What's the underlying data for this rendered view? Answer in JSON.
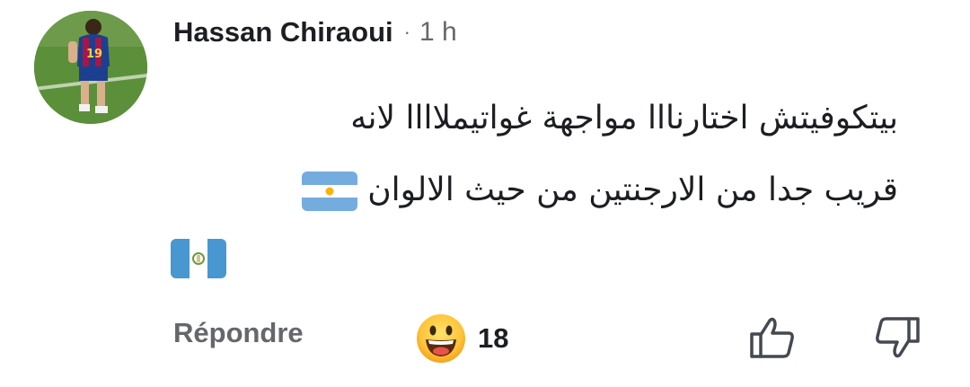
{
  "comment": {
    "author": "Hassan Chiraoui",
    "separator": "·",
    "time": "1 h",
    "text_line1": "بيتكوفيتش  اختارنااا مواجهة غواتيملاااا لانه",
    "text_line2": "قريب جدا من الارجنتين من حيث الالوان",
    "flags": [
      "argentina-flag",
      "guatemala-flag"
    ]
  },
  "actions": {
    "reply_label": "Répondre",
    "reaction_icon": "laughing-face-emoji",
    "reaction_count": "18",
    "like_icon": "thumbs-up-icon",
    "dislike_icon": "thumbs-down-icon"
  },
  "colors": {
    "text": "#1c1e21",
    "muted": "#65676b",
    "argentina_blue": "#74acdf",
    "guatemala_blue": "#4997d0"
  }
}
